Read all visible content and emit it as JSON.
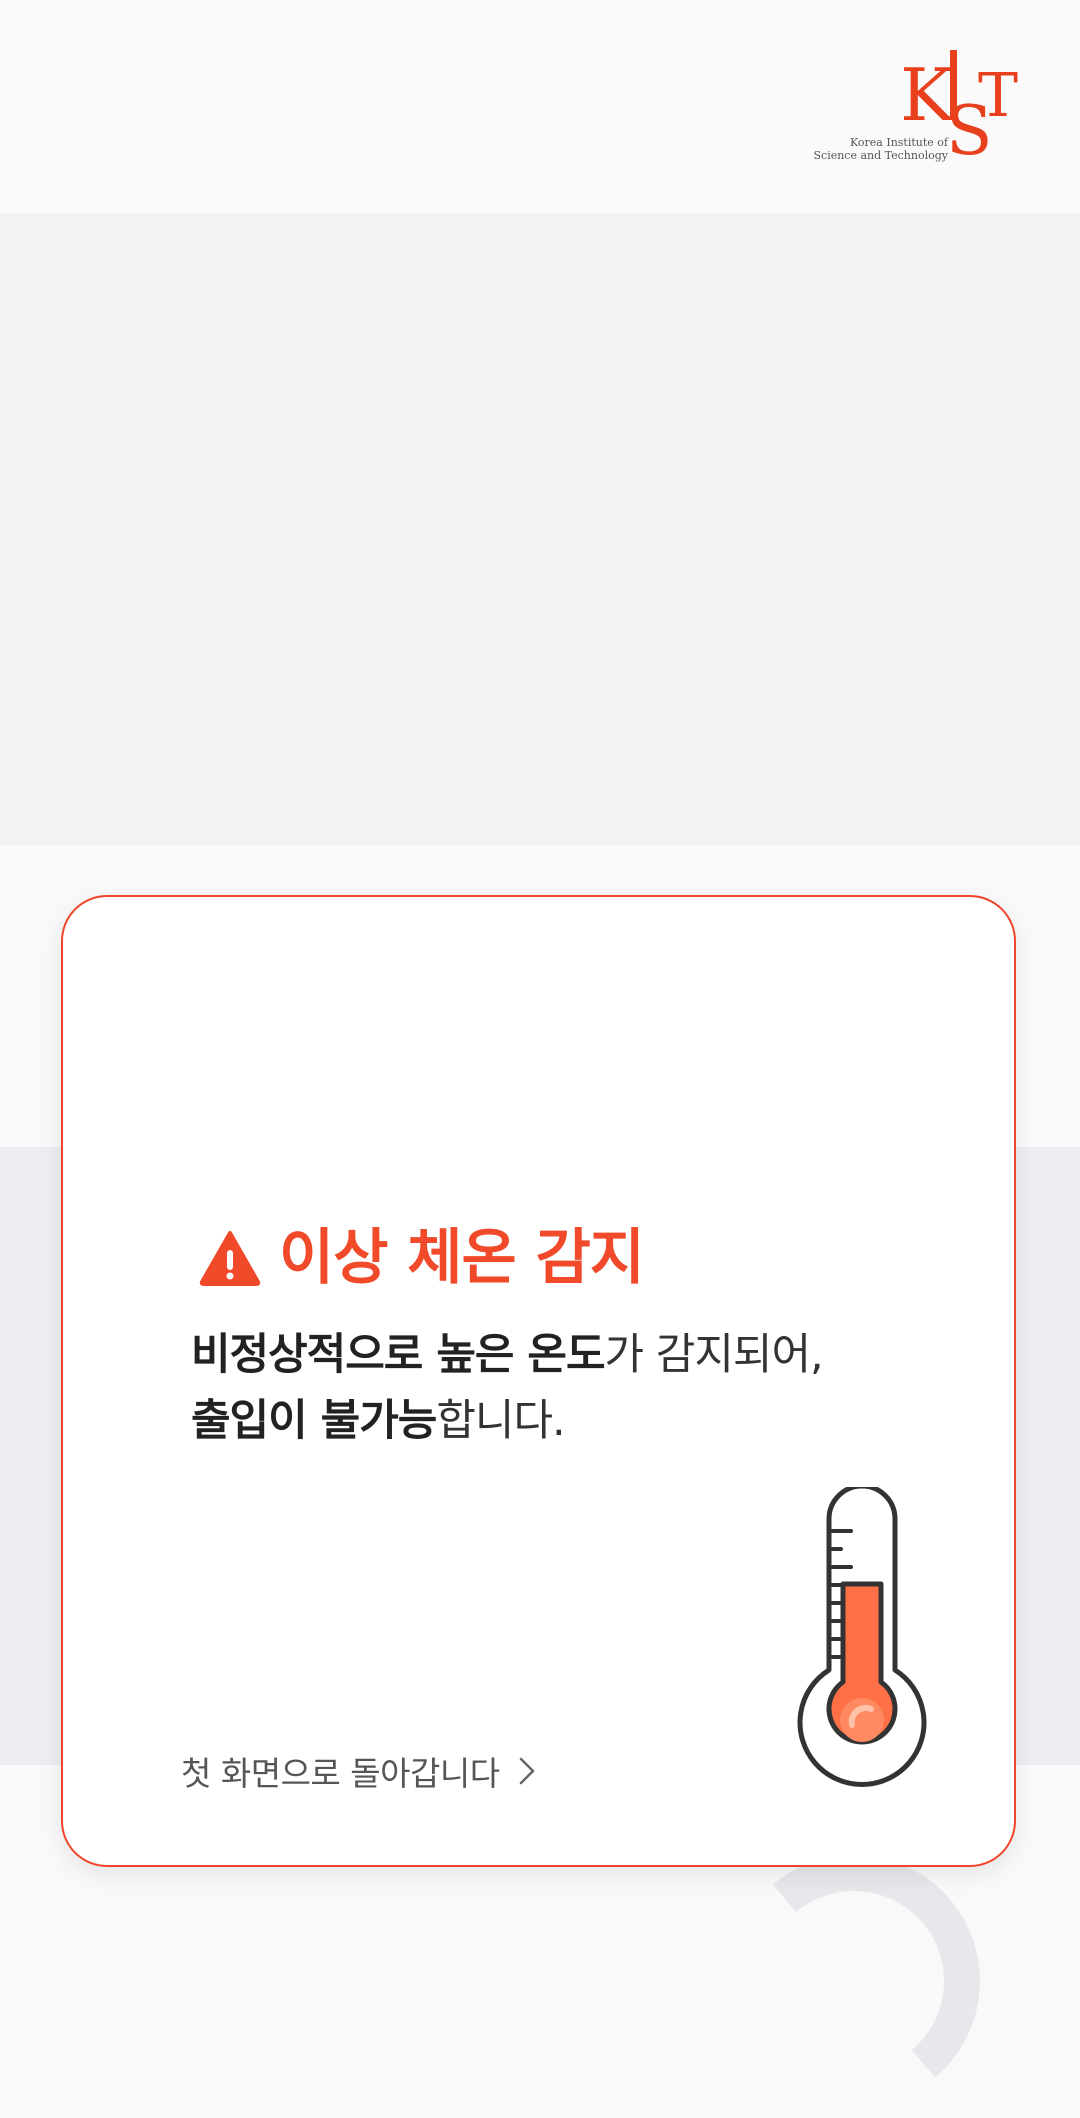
{
  "header": {
    "logo_text": "KIST",
    "logo_sub_line1": "Korea Institute of",
    "logo_sub_line2": "Science and Technology"
  },
  "alert": {
    "icon": "warning-triangle-icon",
    "title": "이상 체온 감지",
    "line1_bold": "비정상적으로 높은 온도",
    "line1_regular": "가 감지되어,",
    "line2_bold": "출입이 불가능",
    "line2_regular": "합니다.",
    "illustration": "thermometer-icon"
  },
  "back_link": {
    "label": "첫 화면으로 돌아갑니다",
    "icon": "chevron-right-icon"
  },
  "colors": {
    "accent": "#f04a2a",
    "thermo_fill": "#ff7046",
    "text_dark": "#222222"
  }
}
